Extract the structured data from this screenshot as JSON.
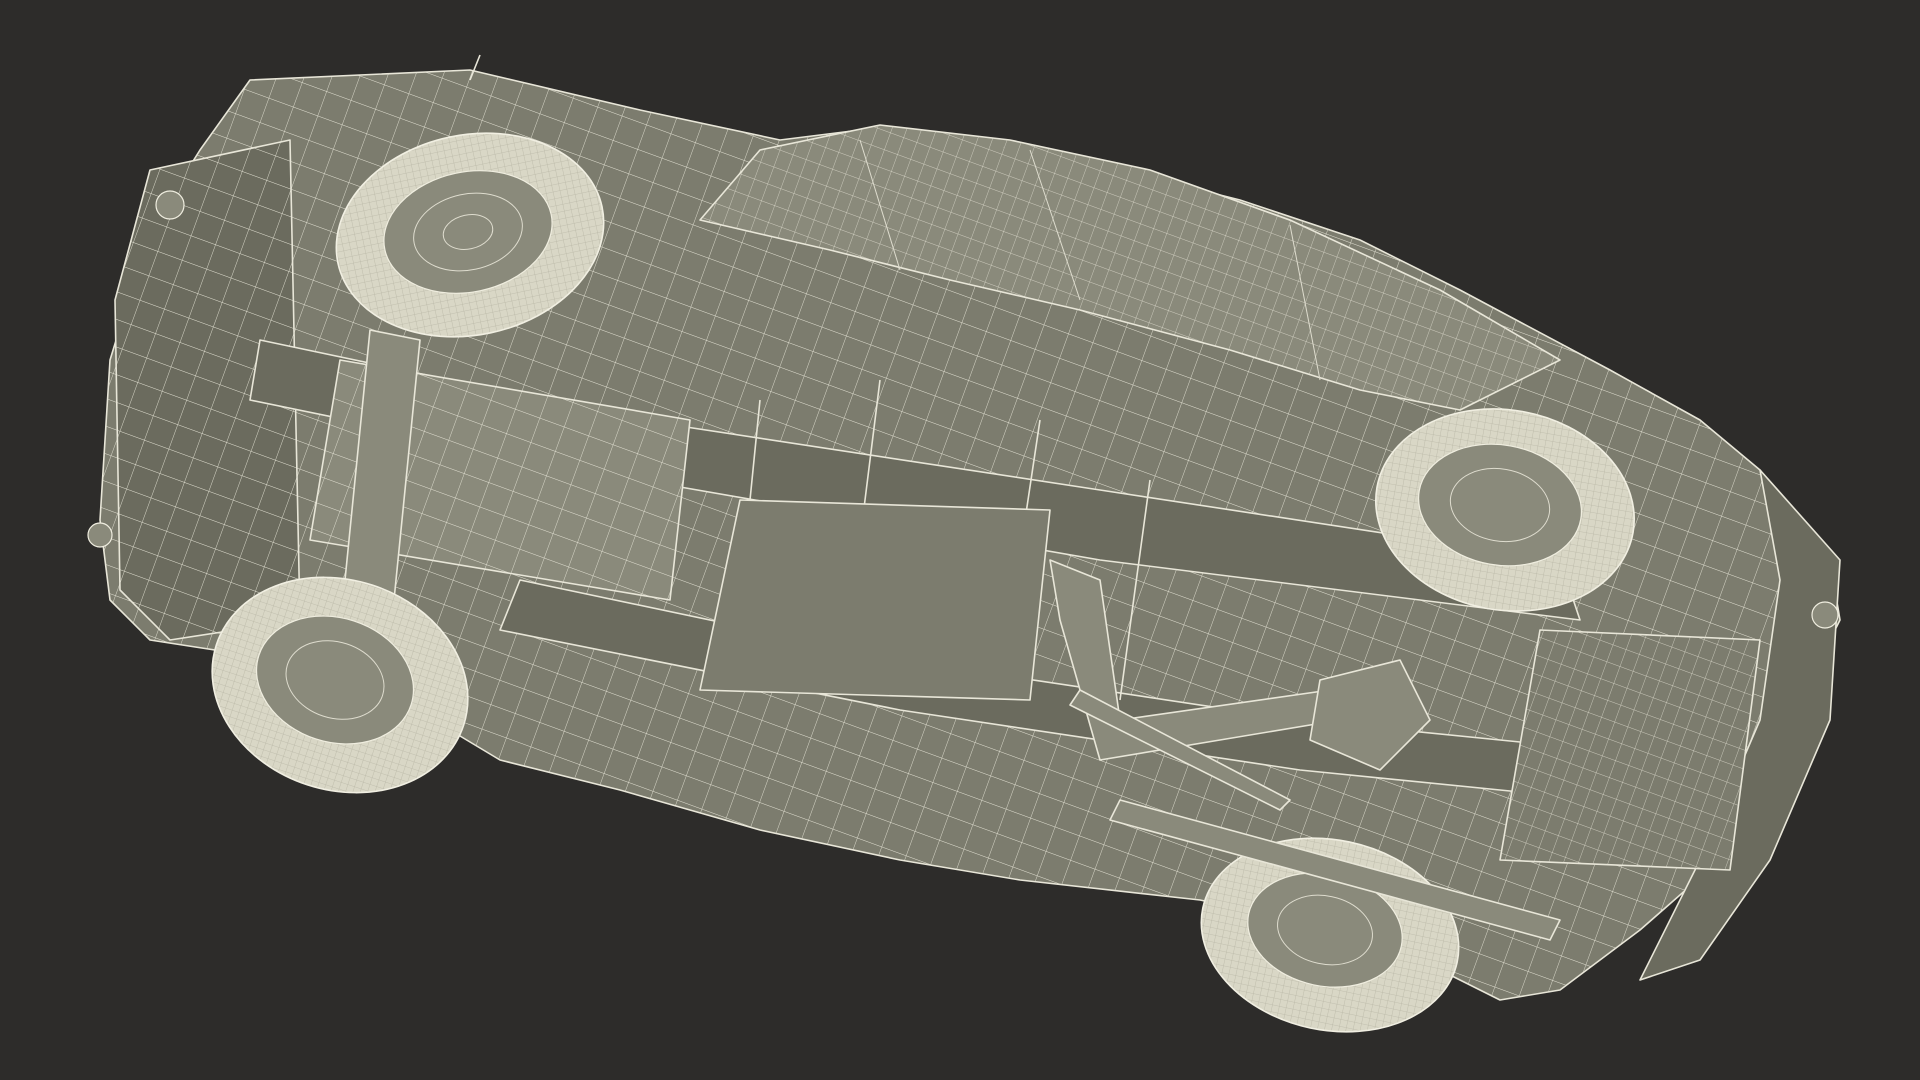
{
  "scene": {
    "subject": "",
    "background_color": "#2d2c2a",
    "mesh_color": "#7c7c6e",
    "wire_color": "#e8e6d8",
    "tire_color": "#d9d7c6",
    "wheels": 4,
    "icons": [
      "car-wireframe-icon"
    ]
  }
}
